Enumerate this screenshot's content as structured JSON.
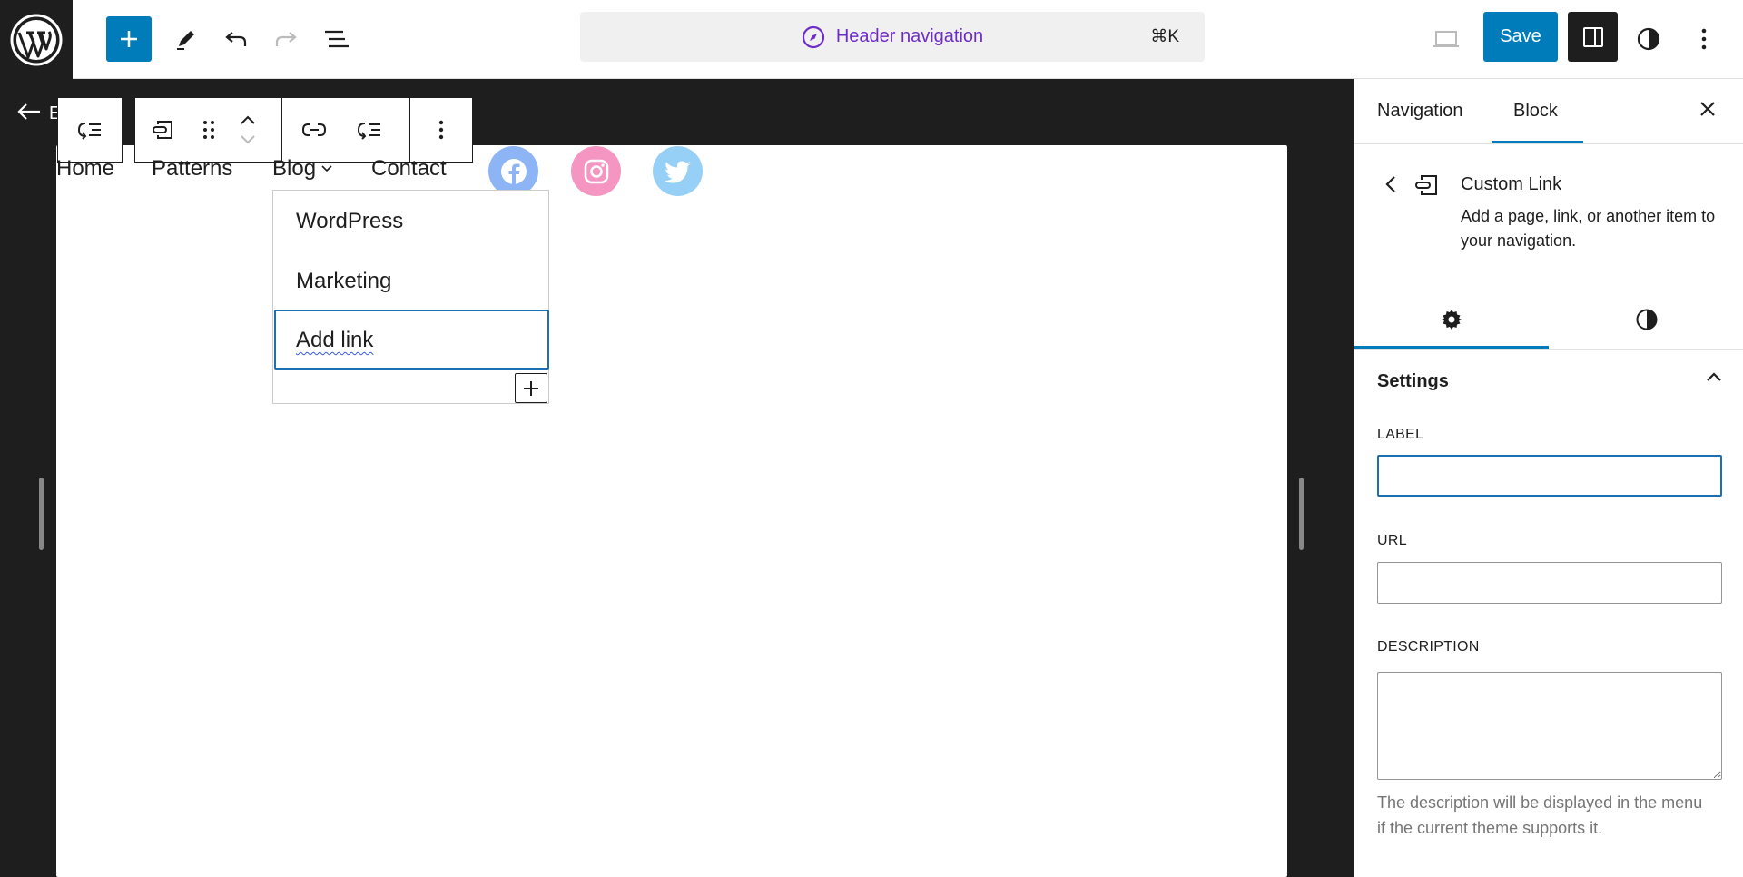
{
  "topbar": {
    "command_label": "Header navigation",
    "command_shortcut": "⌘K",
    "save_label": "Save"
  },
  "canvas": {
    "back_partial": "E",
    "nav_items": [
      {
        "label": "Home"
      },
      {
        "label": "Patterns"
      },
      {
        "label": "Blog"
      },
      {
        "label": "Contact"
      }
    ],
    "social": [
      {
        "name": "facebook-icon",
        "color": "#8db4f5"
      },
      {
        "name": "instagram-icon",
        "color": "#f595c2"
      },
      {
        "name": "twitter-icon",
        "color": "#97d0f7"
      }
    ],
    "submenu": {
      "items": [
        {
          "label": "WordPress"
        },
        {
          "label": "Marketing"
        }
      ],
      "add_link_label": "Add link"
    }
  },
  "sidebar": {
    "tabs": [
      {
        "label": "Navigation"
      },
      {
        "label": "Block"
      }
    ],
    "block_card": {
      "title": "Custom Link",
      "description": "Add a page, link, or another item to your navigation."
    },
    "settings": {
      "title": "Settings",
      "label_field": {
        "label": "LABEL",
        "value": ""
      },
      "url_field": {
        "label": "URL",
        "value": ""
      },
      "description_field": {
        "label": "DESCRIPTION",
        "value": ""
      },
      "description_help": "The description will be displayed in the menu if the current theme supports it."
    }
  },
  "colors": {
    "accent": "#007cba",
    "command_text": "#6e2dc4",
    "dark": "#1e1e1e"
  }
}
